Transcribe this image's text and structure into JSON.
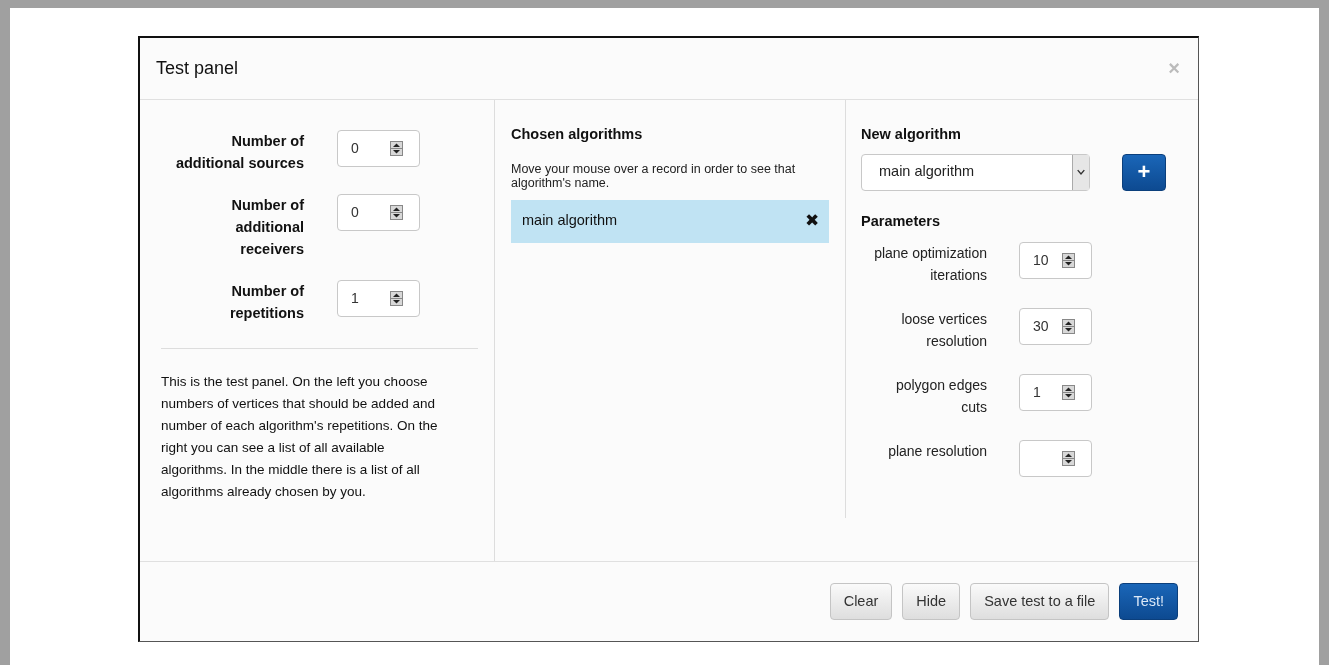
{
  "dialog": {
    "title": "Test panel",
    "close": "×"
  },
  "left": {
    "fields": [
      {
        "label": "Number of additional sources",
        "value": "0"
      },
      {
        "label": "Number of additional receivers",
        "value": "0"
      },
      {
        "label": "Number of repetitions",
        "value": "1"
      }
    ],
    "description": "This is the test panel. On the left you choose numbers of vertices that should be added and number of each algorithm's repetitions. On the right you can see a list of all available algorithms. In the middle there is a list of all algorithms already chosen by you."
  },
  "middle": {
    "heading": "Chosen algorithms",
    "hint": "Move your mouse over a record in order to see that algorithm's name.",
    "records": [
      {
        "name": "main algorithm",
        "remove": "✖"
      }
    ]
  },
  "right": {
    "heading": "New algorithm",
    "select": "main algorithm",
    "add": "+",
    "parameters_heading": "Parameters",
    "parameters": [
      {
        "label": "plane optimization iterations",
        "value": "10"
      },
      {
        "label": "loose vertices resolution",
        "value": "30"
      },
      {
        "label": "polygon edges cuts",
        "value": "1"
      },
      {
        "label": "plane resolution"
      }
    ]
  },
  "footer": {
    "buttons": [
      {
        "label": "Clear",
        "kind": "default"
      },
      {
        "label": "Hide",
        "kind": "default"
      },
      {
        "label": "Save test to a file",
        "kind": "default"
      },
      {
        "label": "Test!",
        "kind": "primary"
      }
    ]
  }
}
